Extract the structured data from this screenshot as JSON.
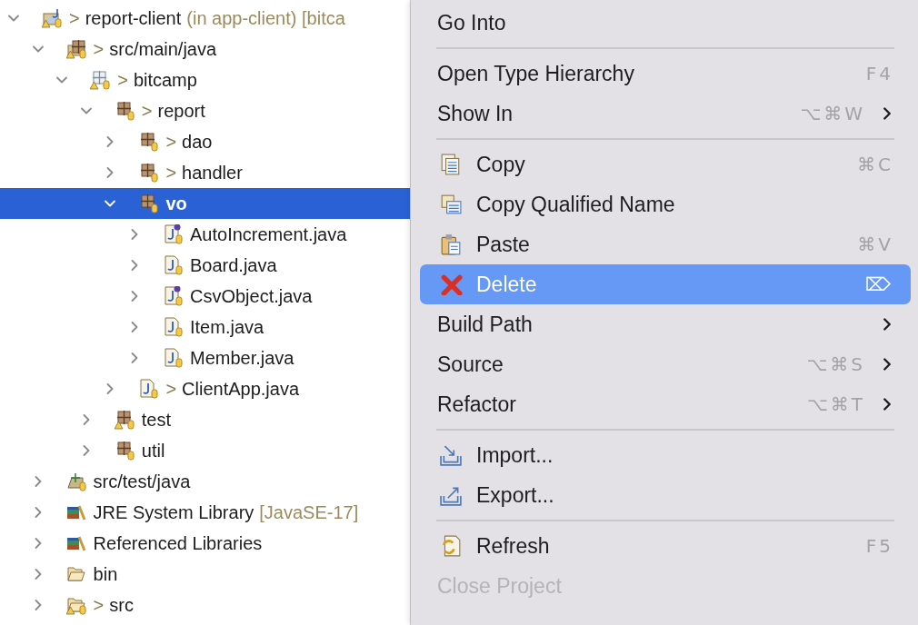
{
  "tree": [
    {
      "label": "report-client",
      "kind": "project",
      "prefix": ">",
      "decoration": "(in app-client) [bitca",
      "warning": true,
      "expanded": true,
      "selected": false,
      "children": [
        {
          "label": "src/main/java",
          "kind": "source-folder",
          "prefix": ">",
          "warning": true,
          "expanded": true,
          "selected": false,
          "children": [
            {
              "label": "bitcamp",
              "kind": "empty-package",
              "prefix": ">",
              "warning": true,
              "expanded": true,
              "selected": false,
              "children": [
                {
                  "label": "report",
                  "kind": "package",
                  "prefix": ">",
                  "warning": false,
                  "expanded": true,
                  "selected": false,
                  "children": [
                    {
                      "label": "dao",
                      "kind": "package",
                      "prefix": ">",
                      "warning": false,
                      "expanded": false,
                      "selected": false
                    },
                    {
                      "label": "handler",
                      "kind": "package",
                      "prefix": ">",
                      "warning": false,
                      "expanded": false,
                      "selected": false
                    },
                    {
                      "label": "vo",
                      "kind": "package",
                      "warning": false,
                      "expanded": true,
                      "selected": true,
                      "children": [
                        {
                          "label": "AutoIncrement.java",
                          "kind": "interface",
                          "warning": false,
                          "expanded": false,
                          "selected": false
                        },
                        {
                          "label": "Board.java",
                          "kind": "class",
                          "warning": false,
                          "expanded": false,
                          "selected": false
                        },
                        {
                          "label": "CsvObject.java",
                          "kind": "interface",
                          "warning": false,
                          "expanded": false,
                          "selected": false
                        },
                        {
                          "label": "Item.java",
                          "kind": "class",
                          "warning": false,
                          "expanded": false,
                          "selected": false
                        },
                        {
                          "label": "Member.java",
                          "kind": "class",
                          "warning": false,
                          "expanded": false,
                          "selected": false
                        }
                      ]
                    },
                    {
                      "label": "ClientApp.java",
                      "kind": "class",
                      "prefix": ">",
                      "warning": false,
                      "expanded": false,
                      "selected": false
                    }
                  ]
                },
                {
                  "label": "test",
                  "kind": "package",
                  "warning": true,
                  "expanded": false,
                  "selected": false
                },
                {
                  "label": "util",
                  "kind": "package",
                  "warning": false,
                  "expanded": false,
                  "selected": false
                }
              ]
            }
          ]
        },
        {
          "label": "src/test/java",
          "kind": "test-folder",
          "warning": false,
          "expanded": false,
          "selected": false
        },
        {
          "label": "JRE System Library",
          "kind": "library",
          "decoration": "[JavaSE-17]",
          "warning": false,
          "expanded": false,
          "selected": false
        },
        {
          "label": "Referenced Libraries",
          "kind": "library",
          "warning": false,
          "expanded": false,
          "selected": false
        },
        {
          "label": "bin",
          "kind": "folder",
          "warning": false,
          "expanded": false,
          "selected": false
        },
        {
          "label": "src",
          "kind": "folder",
          "prefix": ">",
          "warning": true,
          "expanded": false,
          "selected": false
        }
      ]
    }
  ],
  "menu": [
    {
      "kind": "item",
      "label": "Go Into",
      "selected": false,
      "disabled": false,
      "submenu": false
    },
    {
      "kind": "separator"
    },
    {
      "kind": "item",
      "label": "Open Type Hierarchy",
      "shortcut": "F4",
      "selected": false,
      "disabled": false,
      "submenu": false
    },
    {
      "kind": "item",
      "label": "Show In",
      "shortcut": "⌥⌘W",
      "selected": false,
      "disabled": false,
      "submenu": true
    },
    {
      "kind": "separator"
    },
    {
      "kind": "copy",
      "label": "Copy",
      "shortcut": "⌘C",
      "selected": false,
      "disabled": false,
      "submenu": false
    },
    {
      "kind": "copy-name",
      "label": "Copy Qualified Name",
      "selected": false,
      "disabled": false,
      "submenu": false
    },
    {
      "kind": "paste",
      "label": "Paste",
      "shortcut": "⌘V",
      "selected": false,
      "disabled": false,
      "submenu": false
    },
    {
      "kind": "delete",
      "label": "Delete",
      "shortcut": "⌦",
      "selected": true,
      "disabled": false,
      "submenu": false
    },
    {
      "kind": "item",
      "label": "Build Path",
      "selected": false,
      "disabled": false,
      "submenu": true
    },
    {
      "kind": "item",
      "label": "Source",
      "shortcut": "⌥⌘S",
      "selected": false,
      "disabled": false,
      "submenu": true
    },
    {
      "kind": "item",
      "label": "Refactor",
      "shortcut": "⌥⌘T",
      "selected": false,
      "disabled": false,
      "submenu": true
    },
    {
      "kind": "separator"
    },
    {
      "kind": "import",
      "label": "Import...",
      "selected": false,
      "disabled": false,
      "submenu": false
    },
    {
      "kind": "export",
      "label": "Export...",
      "selected": false,
      "disabled": false,
      "submenu": false
    },
    {
      "kind": "separator"
    },
    {
      "kind": "refresh",
      "label": "Refresh",
      "shortcut": "F5",
      "selected": false,
      "disabled": false,
      "submenu": false
    },
    {
      "kind": "item",
      "label": "Close Project",
      "selected": false,
      "disabled": true,
      "submenu": false
    }
  ]
}
